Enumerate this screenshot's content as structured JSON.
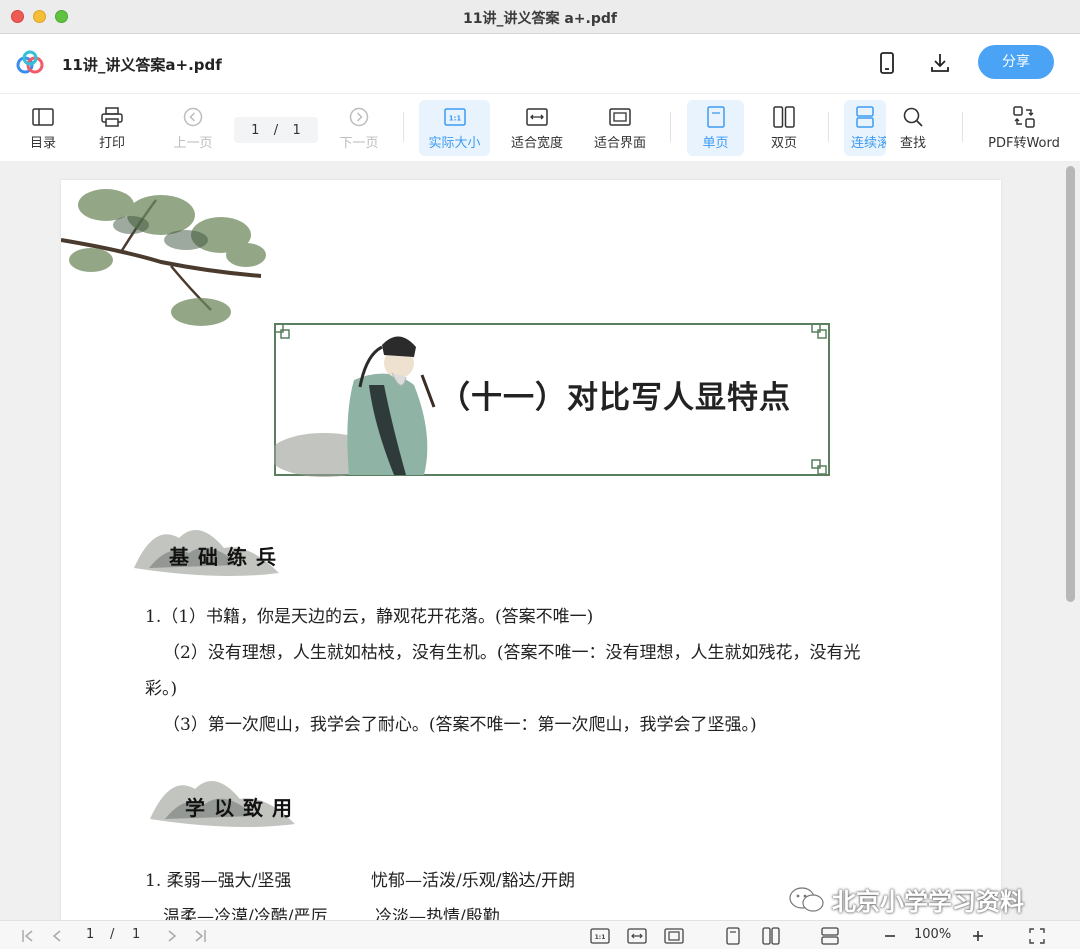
{
  "window": {
    "title": "11讲_讲义答案 a+.pdf"
  },
  "header": {
    "doc_name": "11讲_讲义答案a+.pdf",
    "share_label": "分享",
    "icons": [
      "phone-icon",
      "download-icon"
    ]
  },
  "toolbar": {
    "toc": "目录",
    "print": "打印",
    "prev": "上一页",
    "page_current": "1",
    "page_sep": "/",
    "page_total": "1",
    "next": "下一页",
    "actual_size": "实际大小",
    "fit_width": "适合宽度",
    "fit_page": "适合界面",
    "single": "单页",
    "double": "双页",
    "continuous": "连续滚",
    "find": "查找",
    "pdf_to_word": "PDF转Word"
  },
  "document": {
    "banner_title": "（十一）对比写人显特点",
    "section1": "基础练兵",
    "s1_lines": [
      "1.（1）书籍，你是天边的云，静观花开花落。(答案不唯一)",
      "（2）没有理想，人生就如枯枝，没有生机。(答案不唯一：没有理想，人生就如残花，没有光",
      "彩。)",
      "（3）第一次爬山，我学会了耐心。(答案不唯一：第一次爬山，我学会了坚强。)"
    ],
    "section2": "学以致用",
    "s2_lines": [
      "1. 柔弱—强大/坚强",
      "忧郁—活泼/乐观/豁达/开朗",
      "温柔—冷漠/冷酷/严厉",
      "冷淡—热情/殷勤"
    ]
  },
  "statusbar": {
    "page_current": "1",
    "page_sep": "/",
    "page_total": "1",
    "zoom": "100%"
  },
  "watermark": "北京小学学习资料",
  "colors": {
    "accent": "#4aa3f5",
    "active_bg": "#e8f3fe",
    "frame": "#5a7f5e"
  }
}
